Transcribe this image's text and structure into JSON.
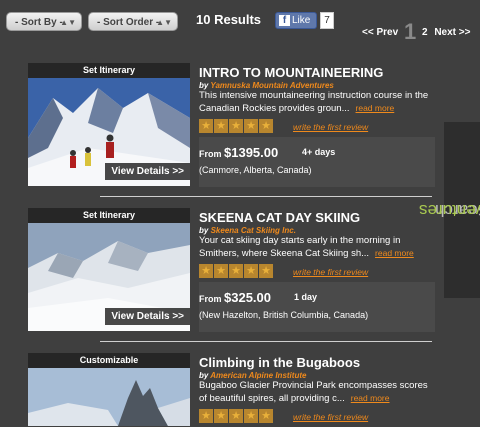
{
  "toolbar": {
    "sort_by": "- Sort By -",
    "sort_order": "- Sort Order -",
    "results": "10 Results",
    "like_label": "Like",
    "like_count": "7",
    "pager_prev": "<< Prev",
    "pager_current": "1",
    "pager_next_page": "2",
    "pager_next": "Next >>"
  },
  "side_tab": {
    "word1": "Search",
    "word2": "Adventures"
  },
  "listings": [
    {
      "badge": "Set Itinerary",
      "title": "INTRO TO MOUNTAINEERING",
      "by": "by",
      "org": "Yamnuska Mountain Adventures",
      "description": "This intensive mountaineering instruction course in the Canadian Rockies provides groun...",
      "read_more": "read more",
      "review_link": "write the first review",
      "price_prefix": "From",
      "price": "$1395.00",
      "duration": "4+ days",
      "location": "(Canmore, Alberta, Canada)",
      "view_details": "View Details >>",
      "rating": 0
    },
    {
      "badge": "Set Itinerary",
      "title": "SKEENA CAT DAY SKIING",
      "by": "by",
      "org": "Skeena Cat Skiing Inc.",
      "description": "Your cat skiing day starts early in the morning in Smithers, where Skeena Cat Skiing sh...",
      "read_more": "read more",
      "review_link": "write the first review",
      "price_prefix": "From",
      "price": "$325.00",
      "duration": "1 day",
      "location": "(New Hazelton, British Columbia, Canada)",
      "view_details": "View Details >>",
      "rating": 0
    },
    {
      "badge": "Customizable",
      "title": "Climbing in the Bugaboos",
      "by": "by",
      "org": "American Alpine Institute",
      "description": "Bugaboo Glacier Provincial Park encompasses scores of beautiful spires, all providing c...",
      "read_more": "read more",
      "review_link": "write the first review",
      "rating": 0
    }
  ]
}
